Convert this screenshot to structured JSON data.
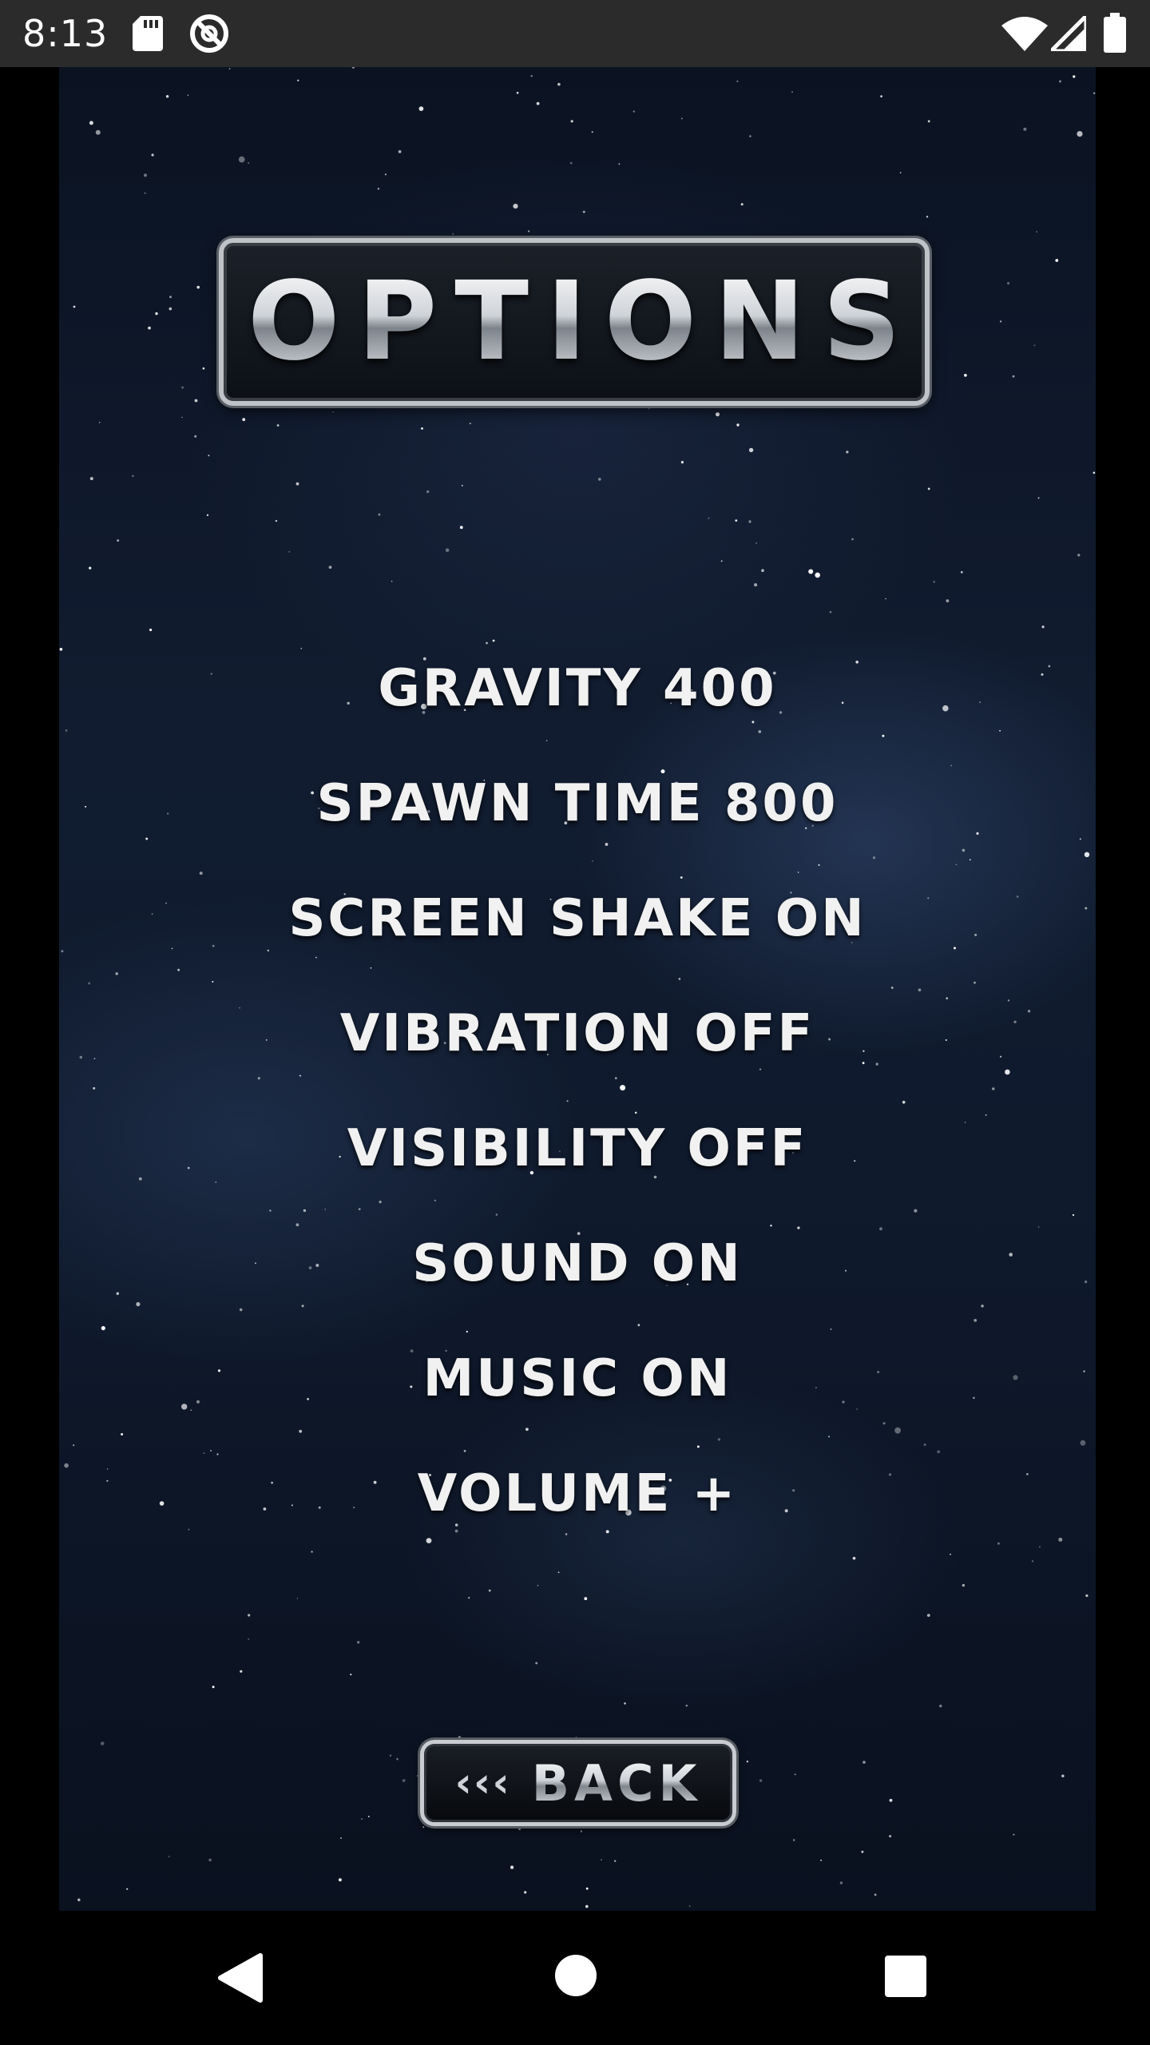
{
  "status_bar": {
    "time": "8:13",
    "icons_left": [
      "sd-card-icon",
      "no-sync-icon"
    ],
    "icons_right": [
      "wifi-icon",
      "cell-signal-icon",
      "battery-icon"
    ]
  },
  "title": {
    "text": "OPTIONS"
  },
  "options": [
    {
      "label": "GRAVITY 400"
    },
    {
      "label": "SPAWN TIME 800"
    },
    {
      "label": "SCREEN SHAKE ON"
    },
    {
      "label": "VIBRATION OFF"
    },
    {
      "label": "VISIBILITY OFF"
    },
    {
      "label": "SOUND ON"
    },
    {
      "label": "MUSIC ON"
    },
    {
      "label": "VOLUME +"
    }
  ],
  "back_button": {
    "arrows": "‹‹‹",
    "label": "BACK"
  },
  "nav_bar": {
    "buttons": [
      "back-triangle-icon",
      "home-circle-icon",
      "recents-square-icon"
    ]
  },
  "colors": {
    "status_bar_bg": "#2b2b2b",
    "space_bg": "#0f1a2d",
    "menu_text": "#f1f1f1"
  }
}
